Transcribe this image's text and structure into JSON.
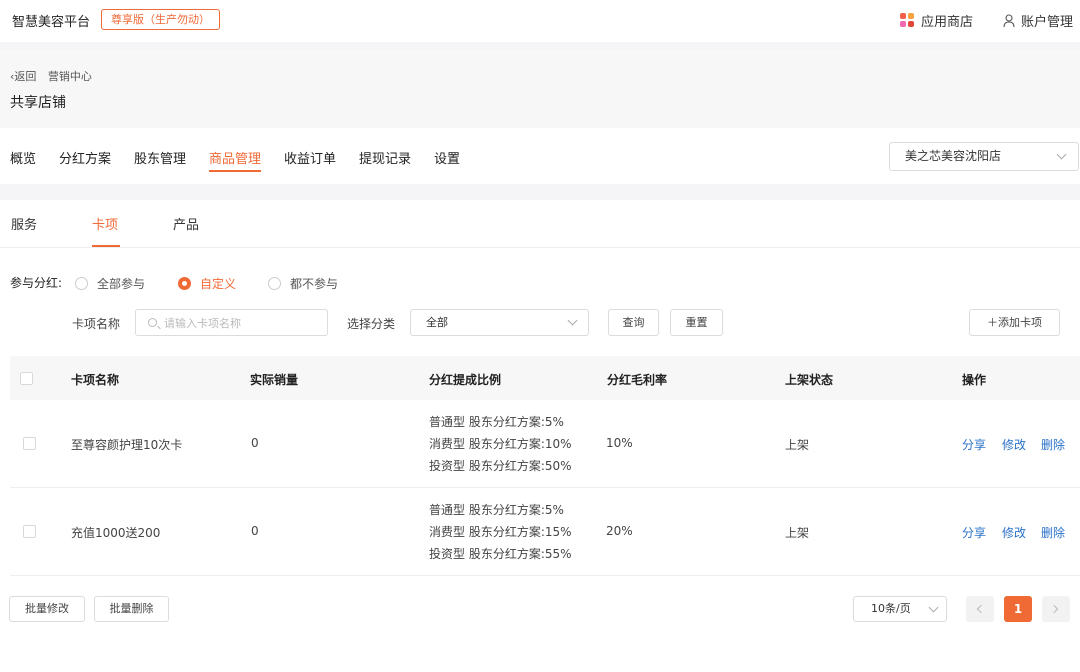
{
  "topbar": {
    "brand": "智慧美容平台",
    "edition_badge": "尊享版（生产勿动）",
    "app_store": "应用商店",
    "account": "账户管理"
  },
  "header": {
    "back": "返回",
    "section": "营销中心",
    "title": "共享店铺"
  },
  "nav": {
    "items": [
      "概览",
      "分红方案",
      "股东管理",
      "商品管理",
      "收益订单",
      "提现记录",
      "设置"
    ],
    "active": "商品管理",
    "store": "美之芯美容沈阳店"
  },
  "subtabs": {
    "items": [
      "服务",
      "卡项",
      "产品"
    ],
    "active": "卡项"
  },
  "dividend": {
    "label": "参与分红:",
    "options": [
      "全部参与",
      "自定义",
      "都不参与"
    ],
    "selected": "自定义"
  },
  "filters": {
    "name_label": "卡项名称",
    "name_placeholder": "请输入卡项名称",
    "category_label": "选择分类",
    "category_value": "全部",
    "query_button": "查询",
    "reset_button": "重置",
    "add_button": "添加卡项"
  },
  "table": {
    "columns": [
      "卡项名称",
      "实际销量",
      "分红提成比例",
      "分红毛利率",
      "上架状态",
      "操作"
    ],
    "rows": [
      {
        "name": "至尊容颜护理10次卡",
        "sales": "0",
        "ratios": [
          "普通型 股东分红方案:5%",
          "消费型 股东分红方案:10%",
          "投资型 股东分红方案:50%"
        ],
        "margin": "10%",
        "status": "上架"
      },
      {
        "name": "充值1000送200",
        "sales": "0",
        "ratios": [
          "普通型 股东分红方案:5%",
          "消费型 股东分红方案:15%",
          "投资型 股东分红方案:55%"
        ],
        "margin": "20%",
        "status": "上架"
      }
    ],
    "actions": [
      "分享",
      "修改",
      "删除"
    ]
  },
  "footer": {
    "batch_edit": "批量修改",
    "batch_delete": "批量删除",
    "page_size": "10条/页",
    "current_page": "1"
  },
  "colors": {
    "accent": "#f06a36",
    "link": "#2a72c8"
  }
}
